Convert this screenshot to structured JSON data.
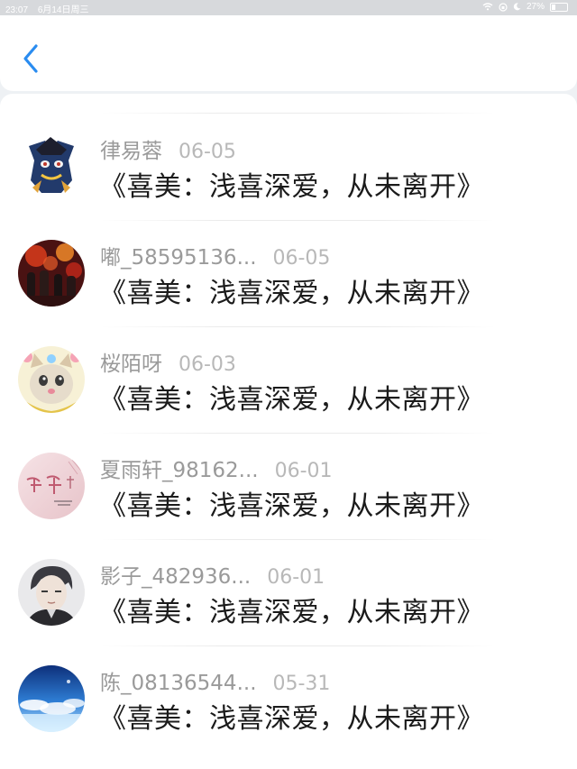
{
  "status_bar": {
    "time": "23:07",
    "date": "6月14日周三",
    "battery": "27%"
  },
  "nav": {
    "back_icon": "chevron-left-icon",
    "accent": "#2a8cf0"
  },
  "items": [
    {
      "name": "律易蓉",
      "date": "06-05",
      "title": "《喜美：浅喜深爱，从未离开》",
      "avatar": "cartoon-hero"
    },
    {
      "name": "嘟_58595136...",
      "date": "06-05",
      "title": "《喜美：浅喜深爱，从未离开》",
      "avatar": "crowd-photo"
    },
    {
      "name": "桜陌呀",
      "date": "06-03",
      "title": "《喜美：浅喜深爱，从未离开》",
      "avatar": "cat"
    },
    {
      "name": "夏雨轩_98162...",
      "date": "06-01",
      "title": "《喜美：浅喜深爱，从未离开》",
      "avatar": "calligraphy"
    },
    {
      "name": "影子_482936...",
      "date": "06-01",
      "title": "《喜美：浅喜深爱，从未离开》",
      "avatar": "anime-boy"
    },
    {
      "name": "陈_08136544...",
      "date": "05-31",
      "title": "《喜美：浅喜深爱，从未离开》",
      "avatar": "sky-clouds"
    }
  ]
}
